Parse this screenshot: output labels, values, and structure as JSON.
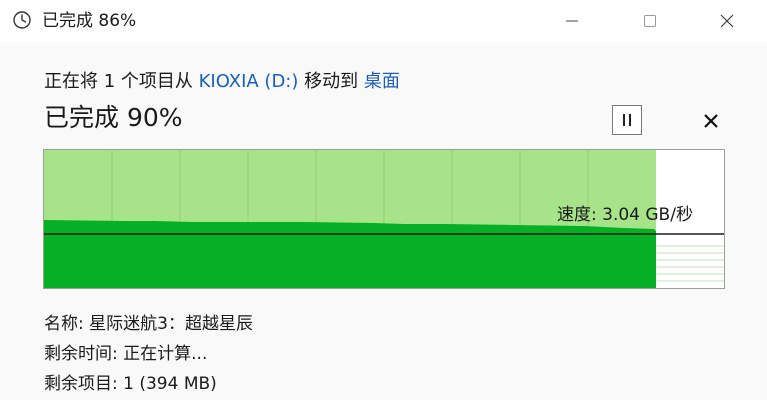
{
  "window": {
    "title": "已完成 86%",
    "icon": "clock-icon",
    "controls": [
      "minimize-icon",
      "maximize-icon",
      "close-icon"
    ]
  },
  "operation": {
    "prefix": "正在将 1 个项目从 ",
    "source": "KIOXIA (D:)",
    "middle": " 移动到 ",
    "destination": "桌面"
  },
  "progress": {
    "label": "已完成 90%",
    "fraction": 0.9
  },
  "buttons": {
    "pause_icon": "pause-icon",
    "cancel_icon": "cancel-icon"
  },
  "graph": {
    "speed_text": "速度: 3.04 GB/秒",
    "colors": {
      "done_area": "#a6e389",
      "speed_fill": "#06b025",
      "line": "#1a1a1a",
      "grid": "#c9dcc0"
    }
  },
  "details": {
    "name_label": "名称:",
    "name_value": "星际迷航3：超越星辰",
    "time_label": "剩余时间:",
    "time_value": "正在计算...",
    "items_label": "剩余项目:",
    "items_value": "1 (394 MB)"
  }
}
